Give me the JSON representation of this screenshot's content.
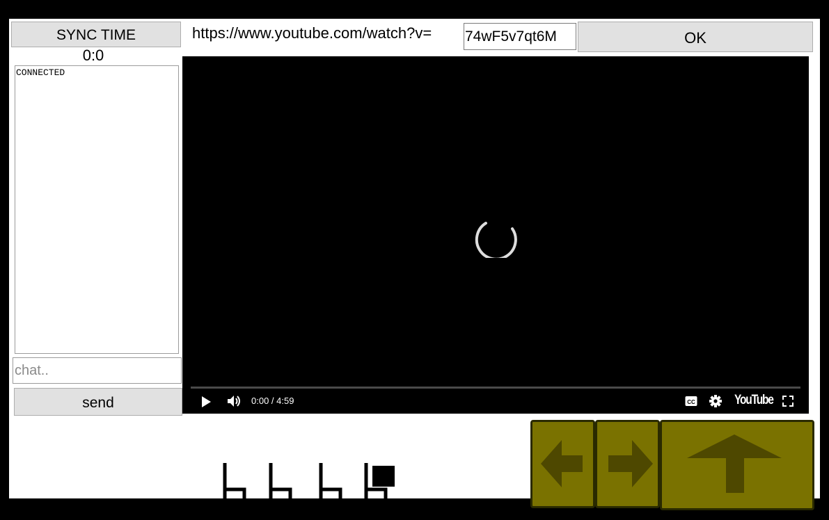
{
  "sidebar": {
    "sync_label": "SYNC TIME",
    "time": "0:0",
    "log_text": "CONNECTED",
    "chat_placeholder": "chat..",
    "send_label": "send"
  },
  "url_bar": {
    "prefix": "https://www.youtube.com/watch?v=",
    "video_id": "74wF5v7qt6M",
    "ok_label": "OK"
  },
  "player": {
    "time_display": "0:00 / 4:59",
    "progress": 0,
    "logo_text": "YouTube",
    "icons": [
      "play-icon",
      "volume-icon",
      "captions-icon",
      "settings-icon",
      "fullscreen-icon",
      "loading-spinner"
    ]
  },
  "controls": {
    "color": "#7a7200",
    "icons": [
      "left-arrow-icon",
      "right-arrow-icon",
      "up-arrow-icon"
    ]
  },
  "scene": {
    "chairs": 4,
    "colors": {
      "background": "#000000",
      "panel": "#ffffff",
      "button": "#e1e1e1"
    }
  }
}
